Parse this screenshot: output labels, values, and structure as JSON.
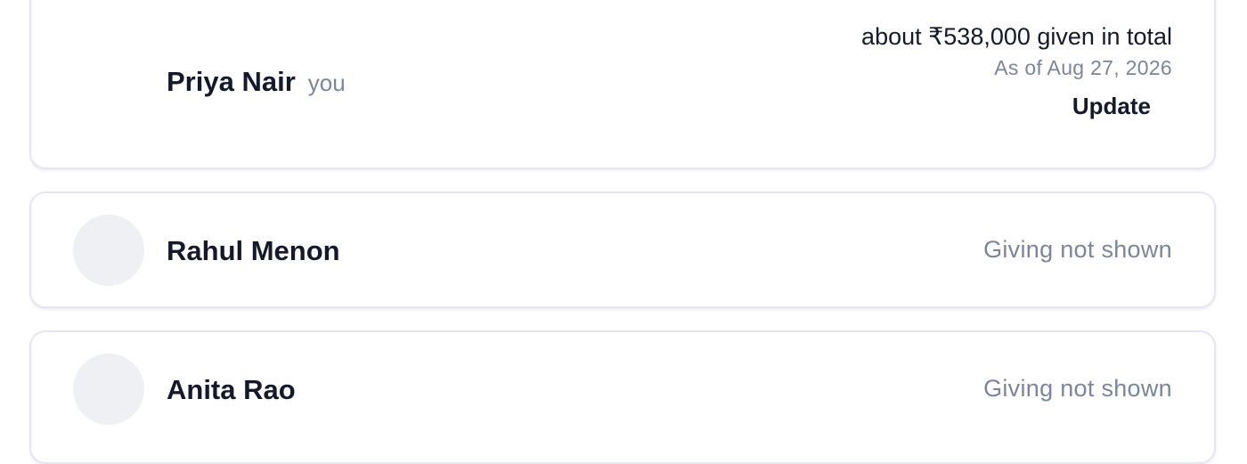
{
  "people": [
    {
      "name": "Priya Nair",
      "you_label": "you",
      "giving_total": "about ₹538,000 given in total",
      "as_of": "As of Aug 27, 2026",
      "action_label": "Update"
    },
    {
      "name": "Rahul Menon",
      "giving_status": "Giving not shown"
    },
    {
      "name": "Anita Rao",
      "giving_status": "Giving not shown"
    }
  ]
}
